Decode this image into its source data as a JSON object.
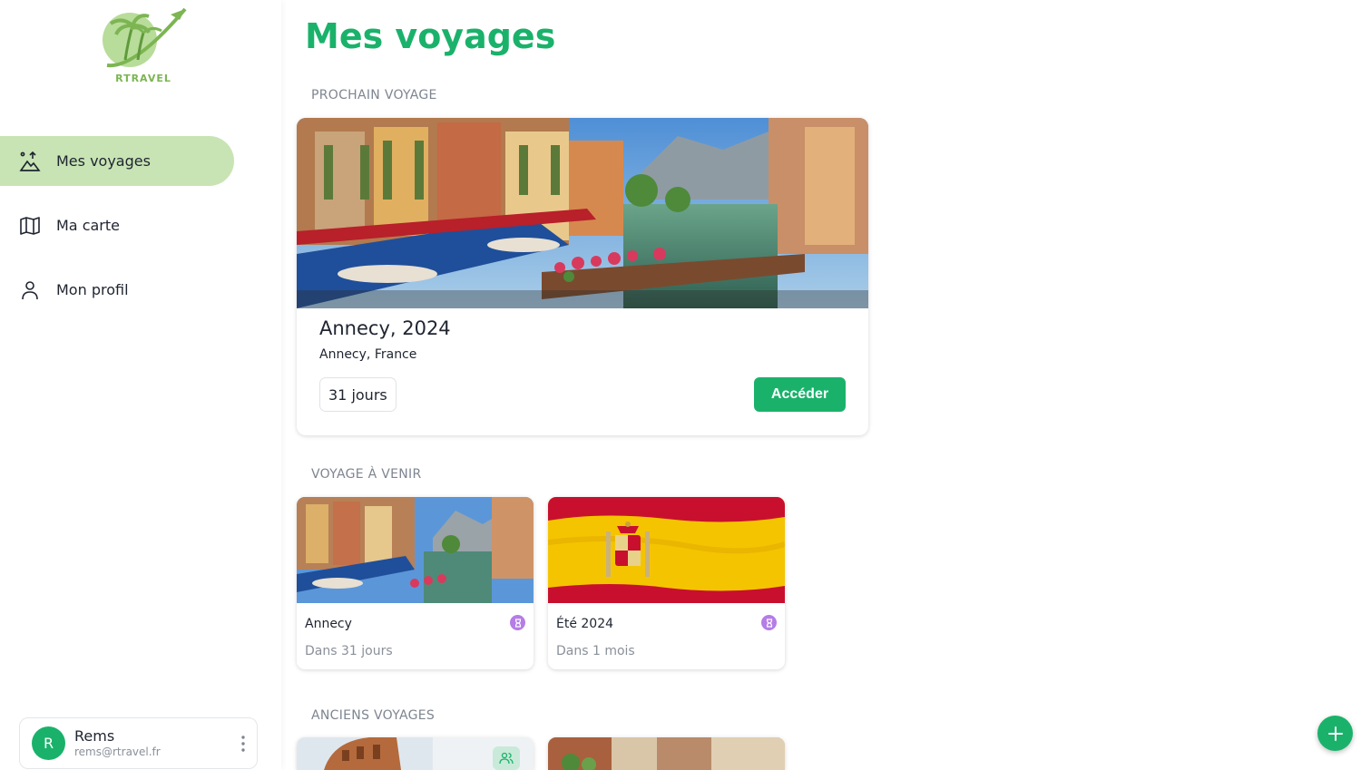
{
  "logo": {
    "text": "RTRAVEL"
  },
  "nav": {
    "items": [
      {
        "label": "Mes voyages",
        "icon": "trips-icon",
        "active": true
      },
      {
        "label": "Ma carte",
        "icon": "map-icon",
        "active": false
      },
      {
        "label": "Mon profil",
        "icon": "user-icon",
        "active": false
      }
    ]
  },
  "user": {
    "initial": "R",
    "name": "Rems",
    "email": "rems@rtravel.fr"
  },
  "page": {
    "title": "Mes voyages"
  },
  "sections": {
    "next": "PROCHAIN VOYAGE",
    "upcoming": "VOYAGE À VENIR",
    "past": "ANCIENS VOYAGES"
  },
  "next_trip": {
    "title": "Annecy, 2024",
    "location": "Annecy, France",
    "duration": "31 jours",
    "action": "Accéder"
  },
  "upcoming_trips": [
    {
      "title": "Annecy",
      "when": "Dans 31 jours",
      "status_icon": "hourglass-icon"
    },
    {
      "title": "Été 2024",
      "when": "Dans 1 mois",
      "status_icon": "hourglass-icon"
    }
  ],
  "past_trips": [
    {
      "image": "colosseum",
      "badge_icon": "group-icon"
    },
    {
      "image": "old-street"
    }
  ],
  "colors": {
    "accent": "#1ab26b",
    "active_nav": "#c8e4b4",
    "pending": "#b57de6"
  }
}
